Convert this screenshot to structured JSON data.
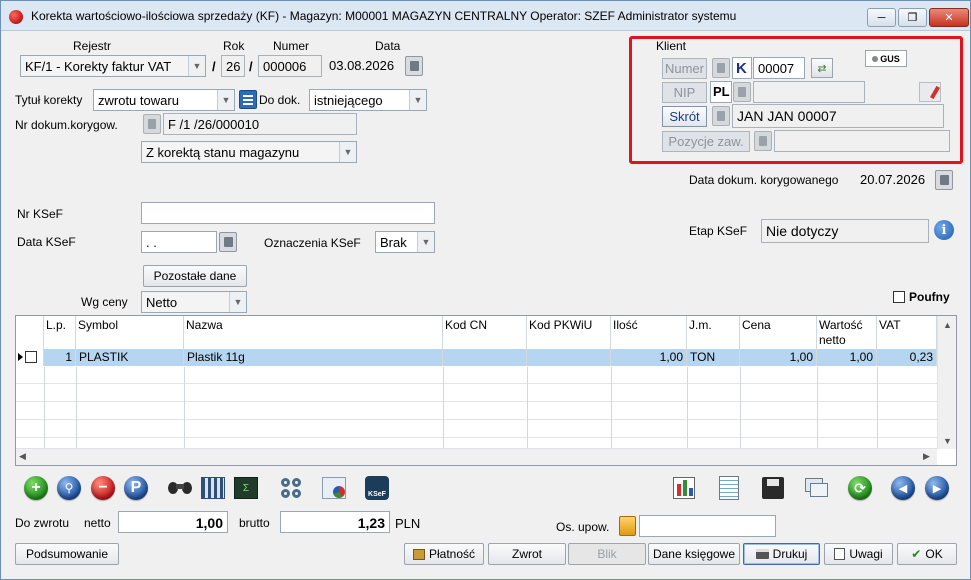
{
  "window": {
    "title": "Korekta wartościowo-ilościowa sprzedaży (KF) - Magazyn: M00001 MAGAZYN CENTRALNY  Operator: SZEF Administrator systemu",
    "min": "─",
    "restore": "❐",
    "close": "✕"
  },
  "header": {
    "rejestr_label": "Rejestr",
    "rok_label": "Rok",
    "numer_label": "Numer",
    "data_label": "Data",
    "rejestr_value": "KF/1   - Korekty faktur VAT",
    "rok_value": "26",
    "numer_value": "000006",
    "data_value": "03.08.2026",
    "slash1": "/",
    "slash2": "/"
  },
  "form": {
    "tytul_label": "Tytuł korekty",
    "tytul_value": "zwrotu towaru",
    "do_dok_label": "Do dok.",
    "do_dok_value": "istniejącego",
    "nr_dok_label": "Nr dokum.korygow.",
    "nr_dok_value": "F /1  /26/000010",
    "korekta_mag": "Z korektą stanu magazynu",
    "nr_ksef_label": "Nr KSeF",
    "nr_ksef_value": "",
    "data_ksef_label": "Data KSeF",
    "data_ksef_value": " .  .",
    "oznaczenia_label": "Oznaczenia KSeF",
    "oznaczenia_value": "Brak",
    "pozostale_btn": "Pozostałe dane",
    "wg_ceny_label": "Wg ceny",
    "wg_ceny_value": "Netto",
    "poufny_label": "Poufny"
  },
  "klient": {
    "group_label": "Klient",
    "gus": "GUS",
    "numer_btn": "Numer",
    "k_letter": "K",
    "numer_value": "00007",
    "nip_btn": "NIP",
    "nip_country": "PL",
    "nip_value": "",
    "skrot_btn": "Skrót",
    "skrot_value": "JAN JAN 00007",
    "pozycje_btn": "Pozycje zaw.",
    "pozycje_value": ""
  },
  "right": {
    "data_kor_label": "Data dokum. korygowanego",
    "data_kor_value": "20.07.2026",
    "etap_label": "Etap KSeF",
    "etap_value": "Nie dotyczy"
  },
  "grid": {
    "headers": [
      "L.p.",
      "Symbol",
      "Nazwa",
      "Kod CN",
      "Kod PKWiU",
      "Ilość",
      "J.m.",
      "Cena",
      "Wartość netto",
      "VAT"
    ],
    "rows": [
      [
        "1",
        "PLASTIK",
        "Plastik 11g",
        "",
        "",
        "1,00",
        "TON",
        "1,00",
        "1,00",
        "0,23"
      ]
    ]
  },
  "totals": {
    "do_zwrotu_label": "Do zwrotu",
    "netto_label": "netto",
    "netto_value": "1,00",
    "brutto_label": "brutto",
    "brutto_value": "1,23",
    "currency": "PLN",
    "os_upow_label": "Os. upow.",
    "os_upow_value": ""
  },
  "buttons": {
    "podsumowanie": "Podsumowanie",
    "platnosc": "Płatność",
    "zwrot": "Zwrot",
    "blik": "Blik",
    "dane_ksiegowe": "Dane księgowe",
    "drukuj": "Drukuj",
    "uwagi": "Uwagi",
    "ok": "OK"
  },
  "toolbar": {
    "add_glyph": "+",
    "remove_glyph": "−",
    "p_glyph": "P",
    "ksef_text": "KSeF",
    "prev_glyph": "◀",
    "next_glyph": "▶"
  }
}
